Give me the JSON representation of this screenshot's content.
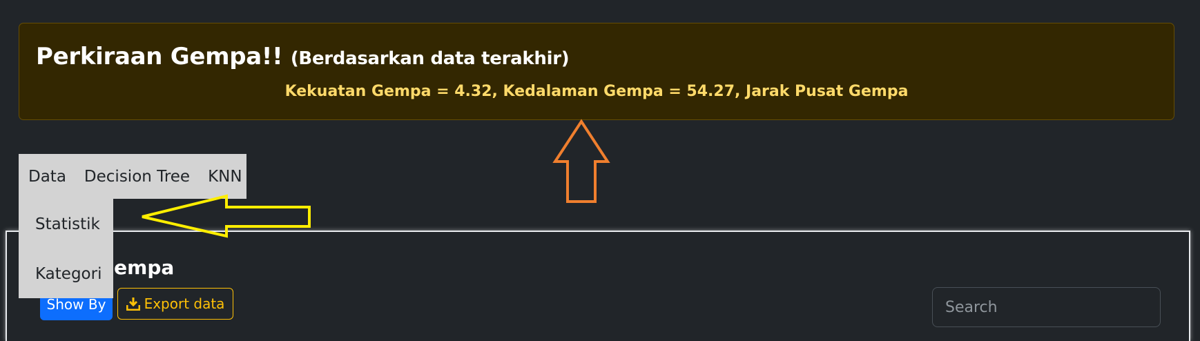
{
  "alert": {
    "heading": "Perkiraan Gempa!!",
    "heading_sub": "(Berdasarkan data terakhir)",
    "prediction": "Kekuatan Gempa = 4.32, Kedalaman Gempa = 54.27, Jarak Pusat Gempa"
  },
  "menu": {
    "items": [
      {
        "label": "Data"
      },
      {
        "label": "Decision Tree"
      },
      {
        "label": "KNN"
      }
    ],
    "dropdown": [
      {
        "label": "Statistik"
      },
      {
        "label": "Kategori"
      }
    ]
  },
  "card": {
    "title": "Data Gempa",
    "show_by_label": "Show By",
    "export_label": "Export data",
    "search_placeholder": "Search"
  },
  "annotations": {
    "orange_arrow_color": "#f07f2e",
    "yellow_arrow_color": "#ffee00"
  }
}
